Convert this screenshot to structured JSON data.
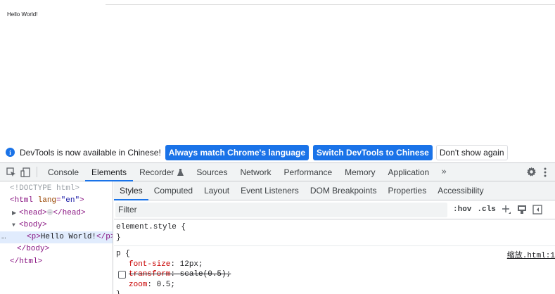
{
  "viewport": {
    "content": "Hello World!"
  },
  "infobar": {
    "message": "DevTools is now available in Chinese!",
    "btn_match": "Always match Chrome's language",
    "btn_switch": "Switch DevTools to Chinese",
    "btn_dismiss": "Don't show again"
  },
  "toolbar": {
    "tabs": [
      "Console",
      "Elements",
      "Recorder",
      "Sources",
      "Network",
      "Performance",
      "Memory",
      "Application"
    ],
    "active_tab": "Elements",
    "more": "»"
  },
  "dom": {
    "doctype": "<!DOCTYPE html>",
    "html_open_tag": "html",
    "html_attr_name": "lang",
    "html_attr_value": "\"en\"",
    "head_open": "<head>",
    "head_close": "</head>",
    "body_open": "<body>",
    "p_line_tag_open": "<p>",
    "p_text": "Hello World!",
    "p_line_tag_close": "</p>",
    "body_close": "</body>",
    "html_close": "</html>",
    "ellipsis": "…",
    "row_menu": "…"
  },
  "subtabs": {
    "items": [
      "Styles",
      "Computed",
      "Layout",
      "Event Listeners",
      "DOM Breakpoints",
      "Properties",
      "Accessibility"
    ],
    "active": "Styles"
  },
  "filter": {
    "placeholder": "Filter",
    "hov": ":hov",
    "cls": ".cls"
  },
  "styles": {
    "element_style": "element.style {",
    "element_style_close": "}",
    "p_selector": "p {",
    "source": "缩放.html:1",
    "decl1_prop": "font-size",
    "decl1_val": "12px;",
    "decl2_prop": "transform",
    "decl2_val": "scale(0.5);",
    "decl3_prop": "zoom",
    "decl3_val": "0.5;",
    "p_close": "}"
  },
  "colors": {
    "accent": "#1a73e8",
    "tag": "#881280",
    "property": "#c80000"
  }
}
